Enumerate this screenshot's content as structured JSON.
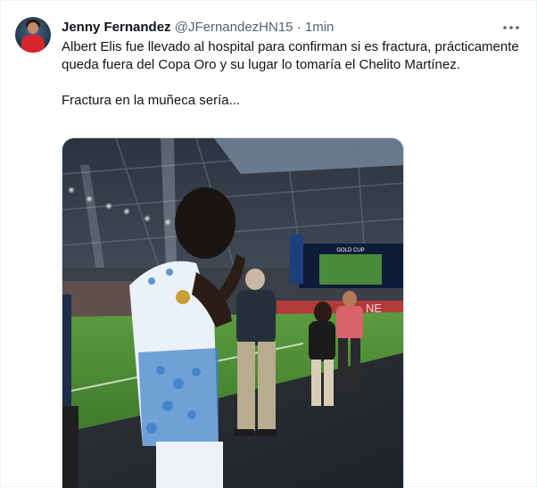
{
  "tweet": {
    "author": {
      "name": "Jenny Fernandez",
      "handle": "@JFernandezHN15",
      "separator": "·",
      "time": "1min"
    },
    "more_icon": "ellipsis-icon",
    "text": {
      "line1": "Albert Elis fue llevado al hospital para confirman si es fractura, prácticamente queda fuera del Copa Oro y su lugar lo tomaría el Chelito Martínez.",
      "line2": "Fractura en la muñeca sería..."
    },
    "media": {
      "stadium_screen_text": "GOLD CUP",
      "ad_board_text": "NE"
    }
  },
  "colors": {
    "text_primary": "#0f1419",
    "text_secondary": "#536471",
    "border": "#eff3f4"
  }
}
